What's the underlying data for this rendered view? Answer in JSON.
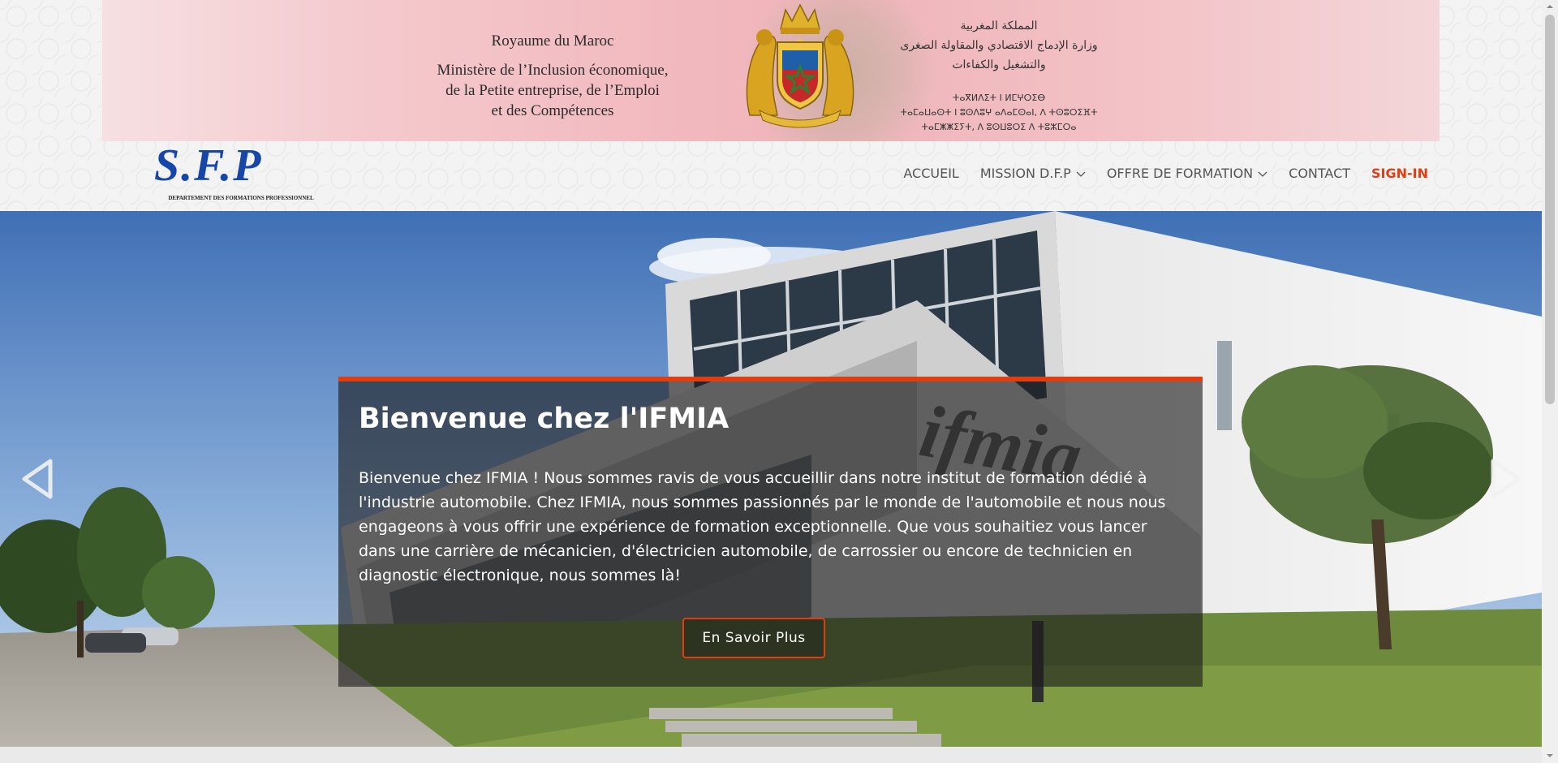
{
  "header": {
    "kingdom_fr": "Royaume du Maroc",
    "ministry_fr": "Ministère de l’Inclusion économique,\nde la Petite entreprise, de l’Emploi\net des Compétences",
    "kingdom_ar": "المملكة المغربية",
    "ministry_ar_1": "وزارة الإدماج الاقتصادي والمقاولة الصغرى",
    "ministry_ar_2": "والتشغيل والكفاءات",
    "tifinagh": "ⵜⴰⴳⵍⴷⵉⵜ ⵏ ⵍⵎⵖⵔⵉⴱ\nⵜⴰⵎⴰⵡⴰⵙⵜ ⵏ ⵓⵙⴷⵓⵖ ⴰⴷⴰⵎⵙⴰⵏ, ⴷ ⵜⵙⵓⵔⵉⴼⵜ\nⵜⴰⵎⵥⵥⵉⵢⵜ, ⴷ ⵓⵙⵡⵓⵔⵉ ⴷ ⵜⵓⵣⵎⵔⴰ",
    "colors": {
      "banner_red": "#efb4b9",
      "emblem_gold": "#d9a520",
      "emblem_green": "#2e7d32"
    }
  },
  "logo": {
    "text": "S.F.P",
    "subtitle": "DEPARTEMENT DES FORMATIONS PROFESSIONNEL",
    "color": "#1546a8"
  },
  "nav": {
    "items": [
      {
        "label": "ACCUEIL",
        "dropdown": false
      },
      {
        "label": "MISSION D.F.P",
        "dropdown": true
      },
      {
        "label": "OFFRE DE FORMATION",
        "dropdown": true
      },
      {
        "label": "CONTACT",
        "dropdown": false
      },
      {
        "label": "SIGN-IN",
        "dropdown": false
      }
    ],
    "accent_color": "#e03e11"
  },
  "hero": {
    "sign_text": "ifmia",
    "title": "Bienvenue chez l'IFMIA",
    "text": "Bienvenue chez IFMIA ! Nous sommes ravis de vous accueillir dans notre institut de formation dédié à l'industrie automobile. Chez IFMIA, nous sommes passionnés par le monde de l'automobile et nous nous engageons à vous offrir une expérience de formation exceptionnelle. Que vous souhaitiez vous lancer dans une carrière de mécanicien, d'électricien automobile, de carrossier ou encore de technicien en diagnostic électronique, nous sommes là!",
    "button_label": "En Savoir Plus",
    "prev_icon": "chevron-left-icon",
    "next_icon": "chevron-right-icon"
  }
}
